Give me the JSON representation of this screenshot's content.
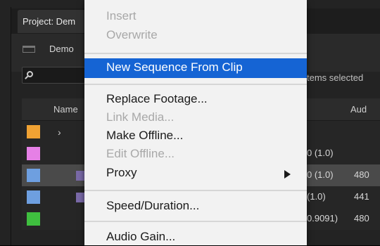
{
  "panel": {
    "tab_label": "Project: Dem",
    "bin_label": "Demo",
    "items_selected": "tems selected",
    "columns": {
      "name": "Name",
      "aud": "Aud"
    },
    "rows": [
      {
        "color": "#f0a233",
        "fps": "",
        "aud": ""
      },
      {
        "color": "#e680e6",
        "fps": "0 (1.0)",
        "aud": ""
      },
      {
        "color": "#6e9fe0",
        "fps": "0 (1.0)",
        "aud": "480",
        "selected": true
      },
      {
        "color": "#6e9fe0",
        "fps": "(1.0)",
        "aud": "441"
      },
      {
        "color": "#3fbf3f",
        "fps": "0.9091)",
        "aud": "480"
      }
    ]
  },
  "menu": {
    "items": [
      {
        "label": "Insert",
        "disabled": true
      },
      {
        "label": "Overwrite",
        "disabled": true
      },
      {
        "label": "New Sequence From Clip",
        "highlighted": true
      },
      {
        "label": "Replace Footage..."
      },
      {
        "label": "Link Media...",
        "disabled": true
      },
      {
        "label": "Make Offline..."
      },
      {
        "label": "Edit Offline...",
        "disabled": true
      },
      {
        "label": "Proxy",
        "submenu": true
      },
      {
        "label": "Speed/Duration..."
      },
      {
        "label": "Audio Gain..."
      }
    ],
    "highlight_color": "#1564d4"
  }
}
